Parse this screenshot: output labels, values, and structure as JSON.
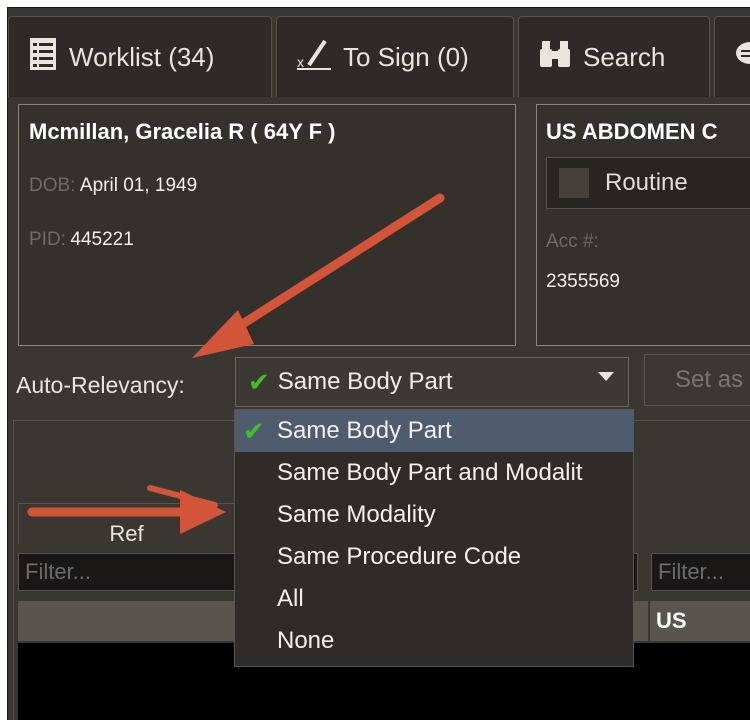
{
  "tabs": [
    {
      "label": "Worklist (34)",
      "icon": "worklist-icon"
    },
    {
      "label": "To Sign (0)",
      "icon": "sign-pen-icon"
    },
    {
      "label": "Search",
      "icon": "binoculars-icon"
    },
    {
      "label": "",
      "icon": "chat-icon"
    }
  ],
  "patient": {
    "name": "Mcmillan, Gracelia R ( 64Y F )",
    "dob_label": "DOB:",
    "dob": "April 01, 1949",
    "pid_label": "PID:",
    "pid": "445221"
  },
  "order": {
    "title": "US ABDOMEN C",
    "priority": "Routine",
    "acc_label": "Acc #:",
    "acc": "2355569"
  },
  "auto_relevancy": {
    "label": "Auto-Relevancy:",
    "selected": "Same Body Part",
    "options": [
      "Same Body Part",
      "Same Body Part and Modalit",
      "Same Modality",
      "Same Procedure Code",
      "All",
      "None"
    ]
  },
  "set_button": "Set as",
  "table": {
    "col_ref": "Ref",
    "filter_placeholder": "Filter...",
    "filter2_placeholder": "Filter...",
    "row_modality": "US"
  },
  "colors": {
    "arrow": "#d2553a",
    "check": "#3fbf2a",
    "selected_row": "#4e5c6e"
  }
}
